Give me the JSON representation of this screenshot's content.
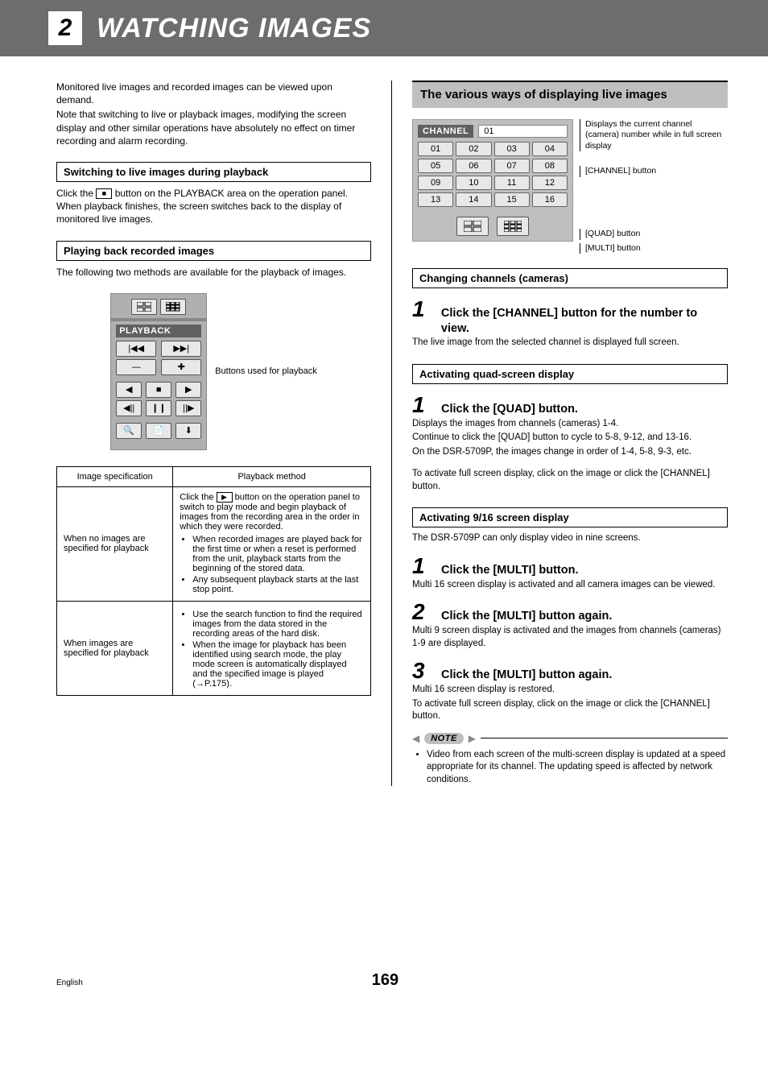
{
  "header": {
    "number": "2",
    "title": "WATCHING IMAGES"
  },
  "left": {
    "intro1": "Monitored live images and recorded images can be viewed upon demand.",
    "intro2": "Note that switching to live or playback images, modifying the screen display and other similar operations have absolutely no effect on timer recording and alarm recording.",
    "h1": "Switching to live images during playback",
    "p1a": "Click the ",
    "p1b": " button on the PLAYBACK area on the operation panel. When playback finishes, the screen switches back to the display of monitored live images.",
    "h2": "Playing back recorded images",
    "p2": "The following two methods are available for the playback of images.",
    "playback_label": "PLAYBACK",
    "caption": "Buttons used for playback",
    "table": {
      "th1": "Image specification",
      "th2": "Playback method",
      "r1c1": "When no images are specified for playback",
      "r1c2_lead": "Click the ",
      "r1c2_tail": " button on the operation panel to switch to play mode and begin playback of images from the recording area in the order in which they were recorded.",
      "r1c2_b1": "When recorded images are played back for the first time or when a reset is performed from the unit, playback starts from the beginning of the stored data.",
      "r1c2_b2": "Any subsequent playback starts at the last stop point.",
      "r2c1": "When images are specified for playback",
      "r2c2_b1": "Use the search function to find the required images from the data stored in the recording areas of the hard disk.",
      "r2c2_b2": "When the image for playback has been identified using search mode, the play mode screen is automatically displayed and the specified image is played (→P.175)."
    }
  },
  "right": {
    "h0": "The various ways of displaying live images",
    "ch_label": "CHANNEL",
    "ch_value": "01",
    "ann1": "Displays the current channel (camera) number while in full screen display",
    "ann2": "[CHANNEL] button",
    "ann3": "[QUAD] button",
    "ann4": "[MULTI] button",
    "ch_buttons": [
      "01",
      "02",
      "03",
      "04",
      "05",
      "06",
      "07",
      "08",
      "09",
      "10",
      "11",
      "12",
      "13",
      "14",
      "15",
      "16"
    ],
    "h1": "Changing channels (cameras)",
    "s1t": "Click the [CHANNEL] button for the number to view.",
    "s1p": "The live image from the selected channel is displayed full screen.",
    "h2": "Activating quad-screen display",
    "s2t": "Click the [QUAD] button.",
    "s2p1": "Displays the images from channels (cameras) 1-4.",
    "s2p2": "Continue to click the [QUAD] button to cycle to 5-8, 9-12, and 13-16.",
    "s2p3": "On the DSR-5709P, the images change in order of 1-4, 5-8, 9-3, etc.",
    "s2p4": "To activate full screen display, click on the image or click the [CHANNEL] button.",
    "h3": "Activating 9/16 screen display",
    "p3": "The DSR-5709P can only display video in nine screens.",
    "s3t": "Click the [MULTI] button.",
    "s3p": "Multi 16 screen display is activated and all camera images can be viewed.",
    "s4t": "Click the [MULTI] button again.",
    "s4p": "Multi 9 screen display is activated and the images from channels (cameras) 1-9 are displayed.",
    "s5t": "Click the [MULTI] button again.",
    "s5p1": "Multi 16 screen display is restored.",
    "s5p2": "To activate full screen display, click on the image or click the [CHANNEL] button.",
    "note_label": "NOTE",
    "note": "Video from each screen of the multi-screen display is updated at a speed appropriate for its channel. The updating speed is affected by network conditions."
  },
  "footer": {
    "lang": "English",
    "page": "169"
  }
}
